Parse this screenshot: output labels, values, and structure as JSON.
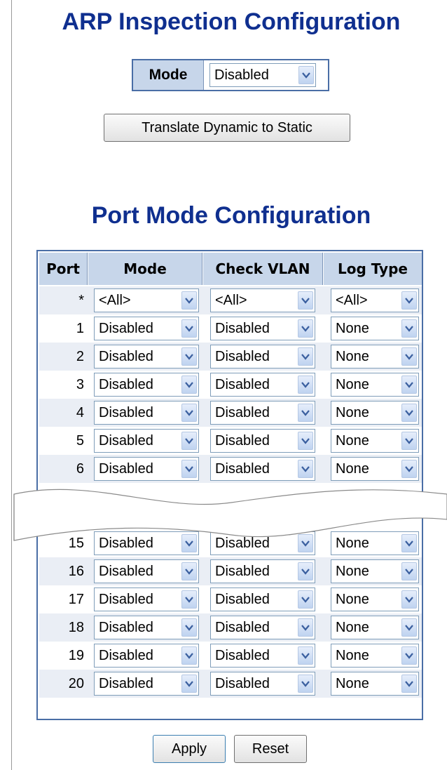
{
  "page": {
    "title": "ARP Inspection Configuration",
    "global_mode_label": "Mode",
    "global_mode_value": "Disabled",
    "translate_button": "Translate Dynamic to Static",
    "subtitle": "Port Mode Configuration"
  },
  "table": {
    "headers": {
      "port": "Port",
      "mode": "Mode",
      "check_vlan": "Check VLAN",
      "log_type": "Log Type"
    },
    "rows": [
      {
        "port": "*",
        "mode": "<All>",
        "check_vlan": "<All>",
        "log_type": "<All>"
      },
      {
        "port": "1",
        "mode": "Disabled",
        "check_vlan": "Disabled",
        "log_type": "None"
      },
      {
        "port": "2",
        "mode": "Disabled",
        "check_vlan": "Disabled",
        "log_type": "None"
      },
      {
        "port": "3",
        "mode": "Disabled",
        "check_vlan": "Disabled",
        "log_type": "None"
      },
      {
        "port": "4",
        "mode": "Disabled",
        "check_vlan": "Disabled",
        "log_type": "None"
      },
      {
        "port": "5",
        "mode": "Disabled",
        "check_vlan": "Disabled",
        "log_type": "None"
      },
      {
        "port": "6",
        "mode": "Disabled",
        "check_vlan": "Disabled",
        "log_type": "None"
      },
      {
        "port": "15",
        "mode": "Disabled",
        "check_vlan": "Disabled",
        "log_type": "None"
      },
      {
        "port": "16",
        "mode": "Disabled",
        "check_vlan": "Disabled",
        "log_type": "None"
      },
      {
        "port": "17",
        "mode": "Disabled",
        "check_vlan": "Disabled",
        "log_type": "None"
      },
      {
        "port": "18",
        "mode": "Disabled",
        "check_vlan": "Disabled",
        "log_type": "None"
      },
      {
        "port": "19",
        "mode": "Disabled",
        "check_vlan": "Disabled",
        "log_type": "None"
      },
      {
        "port": "20",
        "mode": "Disabled",
        "check_vlan": "Disabled",
        "log_type": "None"
      }
    ]
  },
  "buttons": {
    "apply": "Apply",
    "reset": "Reset"
  },
  "icons": {
    "dropdown": "chevron-down-icon"
  },
  "colors": {
    "title": "#0f2f8f",
    "header_bg": "#c7d6ea",
    "border": "#4a6ea6",
    "row_alt": "#eaeef5"
  }
}
